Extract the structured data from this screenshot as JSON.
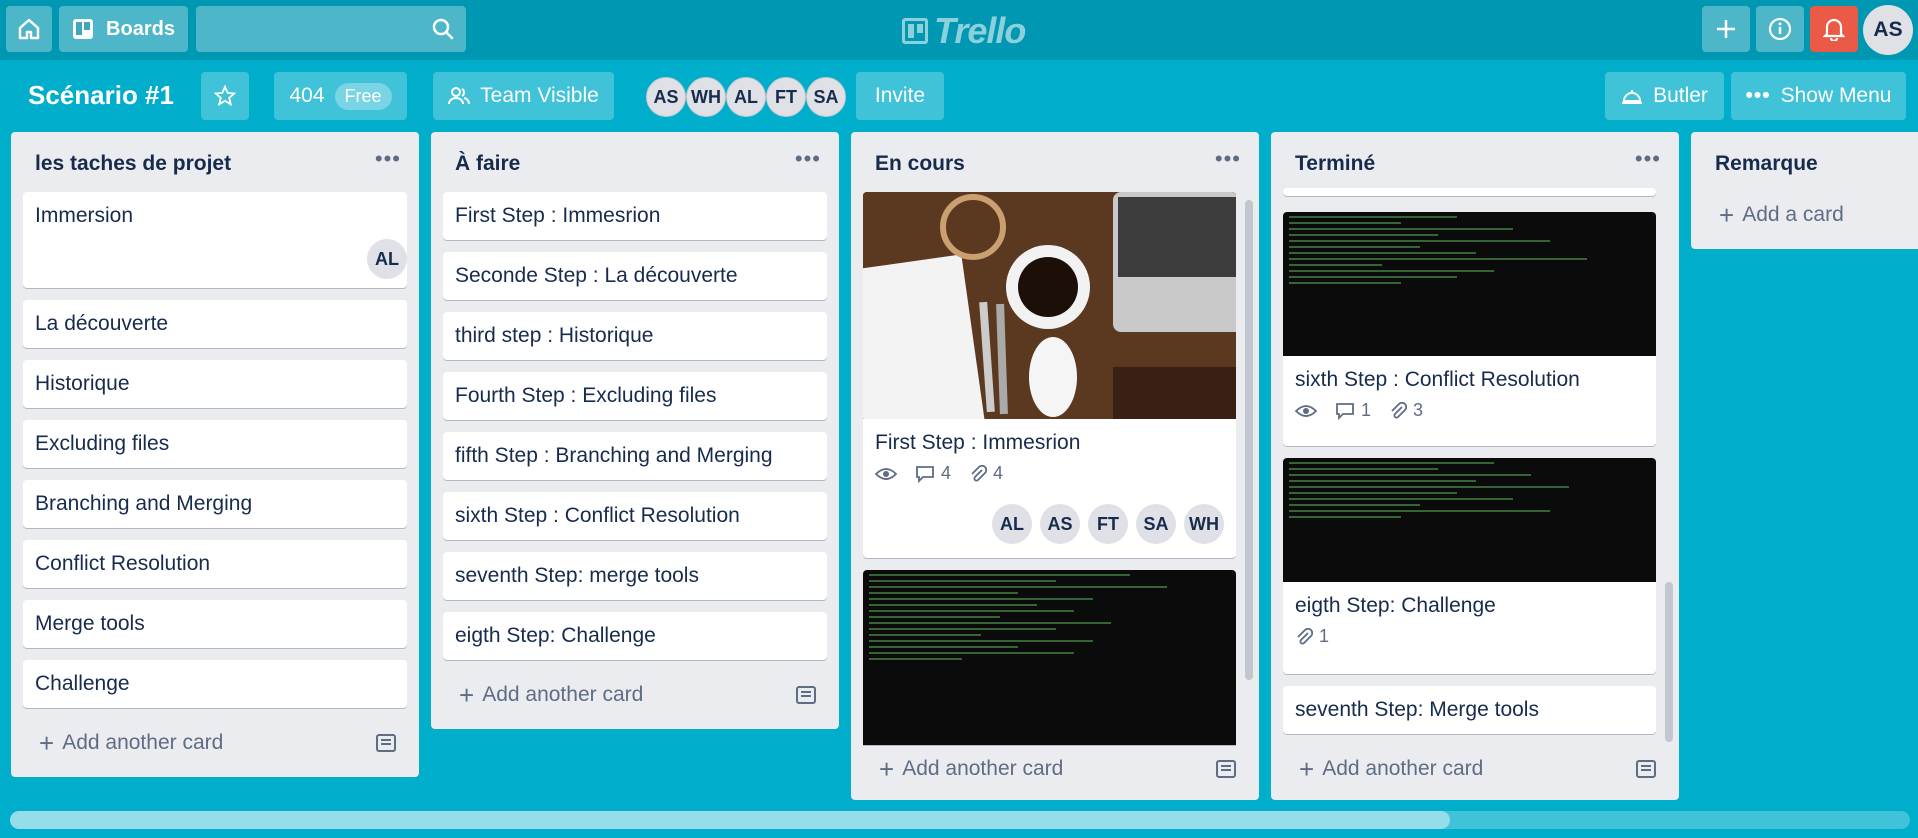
{
  "header": {
    "boards_label": "Boards",
    "logo_text": "Trello",
    "user_initials": "AS"
  },
  "board": {
    "title": "Scénario #1",
    "plan_count": "404",
    "plan_label": "Free",
    "visibility": "Team Visible",
    "members": [
      "AS",
      "WH",
      "AL",
      "FT",
      "SA"
    ],
    "invite": "Invite",
    "butler": "Butler",
    "show_menu": "Show Menu"
  },
  "lists": [
    {
      "title": "les taches de projet",
      "cards": [
        "Immersion",
        "La découverte",
        "Historique",
        "Excluding files",
        "Branching and Merging",
        "Conflict Resolution",
        "Merge tools",
        "Challenge"
      ],
      "card0_member": "AL",
      "add": "Add another card"
    },
    {
      "title": "À faire",
      "cards": [
        "First Step : Immesrion",
        "Seconde Step : La découverte",
        "third step : Historique",
        "Fourth Step : Excluding files",
        "fifth Step : Branching and Merging",
        "sixth Step : Conflict Resolution",
        "seventh Step: merge tools",
        "eigth Step: Challenge"
      ],
      "add": "Add another card"
    },
    {
      "title": "En cours",
      "cards": [
        "First Step : Immesrion"
      ],
      "card0_comments": "4",
      "card0_attachments": "4",
      "card0_members": [
        "AL",
        "AS",
        "FT",
        "SA",
        "WH"
      ],
      "add": "Add another card"
    },
    {
      "title": "Terminé",
      "cards": [
        "sixth Step : Conflict Resolution",
        "eigth Step: Challenge",
        "seventh Step: Merge tools"
      ],
      "card0_comments": "1",
      "card0_attachments": "3",
      "card1_attachments": "1",
      "add": "Add another card"
    },
    {
      "title": "Remarque",
      "add": "Add a card"
    }
  ],
  "colors": {
    "board_bg": "#00aecc",
    "header_bg": "#0097b2",
    "notification": "#eb5a46",
    "list_bg": "#ebecf0"
  }
}
